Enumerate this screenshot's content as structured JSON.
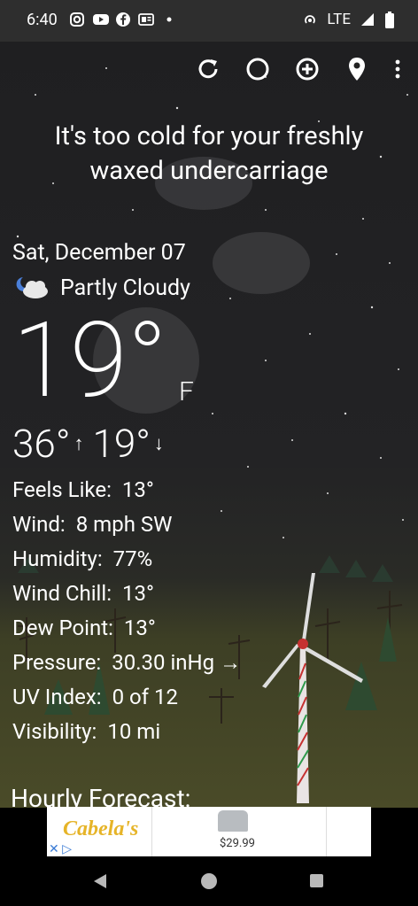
{
  "status_bar": {
    "time": "6:40",
    "network": "LTE",
    "icons": [
      "instagram-icon",
      "youtube-icon",
      "facebook-icon",
      "news-icon",
      "dot-icon"
    ],
    "right_icons": [
      "hotspot-icon",
      "signal-icon",
      "battery-icon"
    ]
  },
  "toolbar": {
    "buttons": [
      "refresh-icon",
      "moon-icon",
      "add-icon",
      "location-icon",
      "overflow-menu-icon"
    ]
  },
  "weather": {
    "message": "It's too cold for your freshly waxed undercarriage",
    "date": "Sat, December 07",
    "condition": "Partly Cloudy",
    "temperature": "19°",
    "unit": "F",
    "high": "36°",
    "low": "19°"
  },
  "details": [
    {
      "label": "Feels Like:",
      "value": "13°"
    },
    {
      "label": "Wind:",
      "value": "8 mph SW"
    },
    {
      "label": "Humidity:",
      "value": "77%"
    },
    {
      "label": "Wind Chill:",
      "value": "13°"
    },
    {
      "label": "Dew Point:",
      "value": "13°"
    },
    {
      "label": "Pressure:",
      "value": "30.30 inHg →"
    },
    {
      "label": "UV Index:",
      "value": "0 of 12"
    },
    {
      "label": "Visibility:",
      "value": "10 mi"
    }
  ],
  "hourly": {
    "title": "Hourly Forecast:"
  },
  "ad": {
    "brand": "Cabela's",
    "price": "$29.99"
  },
  "colors": {
    "background": "#222224",
    "ground": "#4a4b28",
    "text": "#ffffff"
  }
}
